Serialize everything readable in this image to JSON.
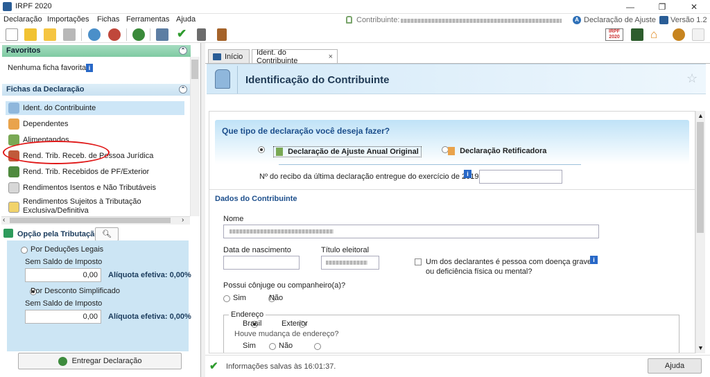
{
  "window": {
    "title": "IRPF 2020"
  },
  "menu": {
    "items": [
      "Declaração",
      "Importações",
      "Fichas",
      "Ferramentas",
      "Ajuda"
    ]
  },
  "header_right": {
    "contribuinte_label": "Contribuinte:",
    "declaration_type": "Declaração de Ajuste",
    "version": "Versão 1.2"
  },
  "favorites": {
    "title": "Favoritos",
    "empty_text": "Nenhuma ficha favorita"
  },
  "fichas": {
    "title": "Fichas da Declaração",
    "items": [
      "Ident. do Contribuinte",
      "Dependentes",
      "Alimentandos",
      "Rend. Trib. Receb. de Pessoa Jurídica",
      "Rend. Trib. Recebidos de PF/Exterior",
      "Rendimentos Isentos e Não Tributáveis",
      "Rendimentos Sujeitos à Tributação",
      "Exclusiva/Definitiva"
    ]
  },
  "tributacao": {
    "label": "Opção pela Tributação:",
    "opt1": "Por Deduções Legais",
    "opt1_sub": "Sem Saldo de Imposto",
    "opt1_value": "0,00",
    "opt1_aliquota": "Alíquota efetiva: 0,00%",
    "opt2": "Por Desconto Simplificado",
    "opt2_sub": "Sem Saldo de Imposto",
    "opt2_value": "0,00",
    "opt2_aliquota": "Alíquota efetiva: 0,00%",
    "submit": "Entregar Declaração"
  },
  "tabs": {
    "home": "Início",
    "active": "Ident. do Contribuinte",
    "close": "×"
  },
  "page": {
    "title": "Identificação do Contribuinte"
  },
  "form": {
    "question": "Que tipo de declaração você deseja fazer?",
    "option_original": "Declaração de Ajuste Anual Original",
    "option_retificadora": "Declaração Retificadora",
    "recibo_label": "Nº do recibo da última declaração entregue do exercício de 2019",
    "section_dados": "Dados do Contribuinte",
    "nome_label": "Nome",
    "nascimento_label": "Data de nascimento",
    "titulo_label": "Título eleitoral",
    "doenca_label_1": "Um dos declarantes é pessoa com doença grave",
    "doenca_label_2": "ou deficiência física ou mental?",
    "conjuge_label": "Possui cônjuge ou companheiro(a)?",
    "sim": "Sim",
    "nao": "Não",
    "endereco_legend": "Endereço",
    "brasil": "Brasil",
    "exterior": "Exterior",
    "mudanca_label": "Houve mudança de endereço?"
  },
  "status": {
    "text": "Informações salvas às 16:01:37.",
    "help_button": "Ajuda"
  }
}
